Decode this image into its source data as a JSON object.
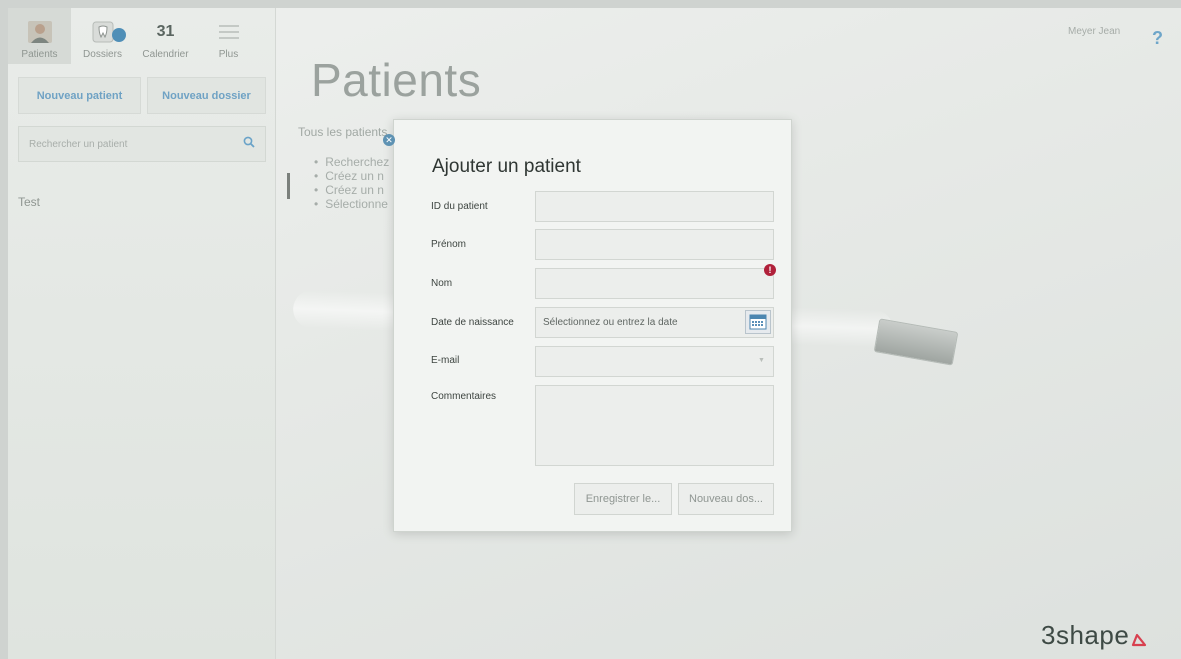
{
  "nav": {
    "items": [
      {
        "label": "Patients",
        "icon": "patient-avatar-icon"
      },
      {
        "label": "Dossiers",
        "icon": "tooth-icon"
      },
      {
        "label": "Calendrier",
        "icon": "calendar-icon",
        "day": "31"
      },
      {
        "label": "Plus",
        "icon": "menu-icon"
      }
    ]
  },
  "sidebar": {
    "new_patient_label": "Nouveau patient",
    "new_dossier_label": "Nouveau dossier",
    "search_placeholder": "Rechercher un patient",
    "list": [
      "Test"
    ]
  },
  "main": {
    "title": "Patients",
    "intro": "Tous les patients",
    "bullets": [
      "Recherchez",
      "Créez un n",
      "Créez un n",
      "Sélectionne"
    ]
  },
  "header": {
    "user_name": "Meyer Jean",
    "help_glyph": "?"
  },
  "modal": {
    "title": "Ajouter un patient",
    "fields": {
      "patient_id_label": "ID du patient",
      "first_name_label": "Prénom",
      "last_name_label": "Nom",
      "birthdate_label": "Date de naissance",
      "birthdate_placeholder": "Sélectionnez ou entrez la date",
      "email_label": "E-mail",
      "comments_label": "Commentaires"
    },
    "save_label": "Enregistrer le...",
    "new_dossier_label": "Nouveau dos..."
  },
  "brand": {
    "name": "3shape"
  },
  "colors": {
    "accent": "#5e92b3",
    "error": "#b0203a",
    "link_blue": "#6fa2c4"
  }
}
